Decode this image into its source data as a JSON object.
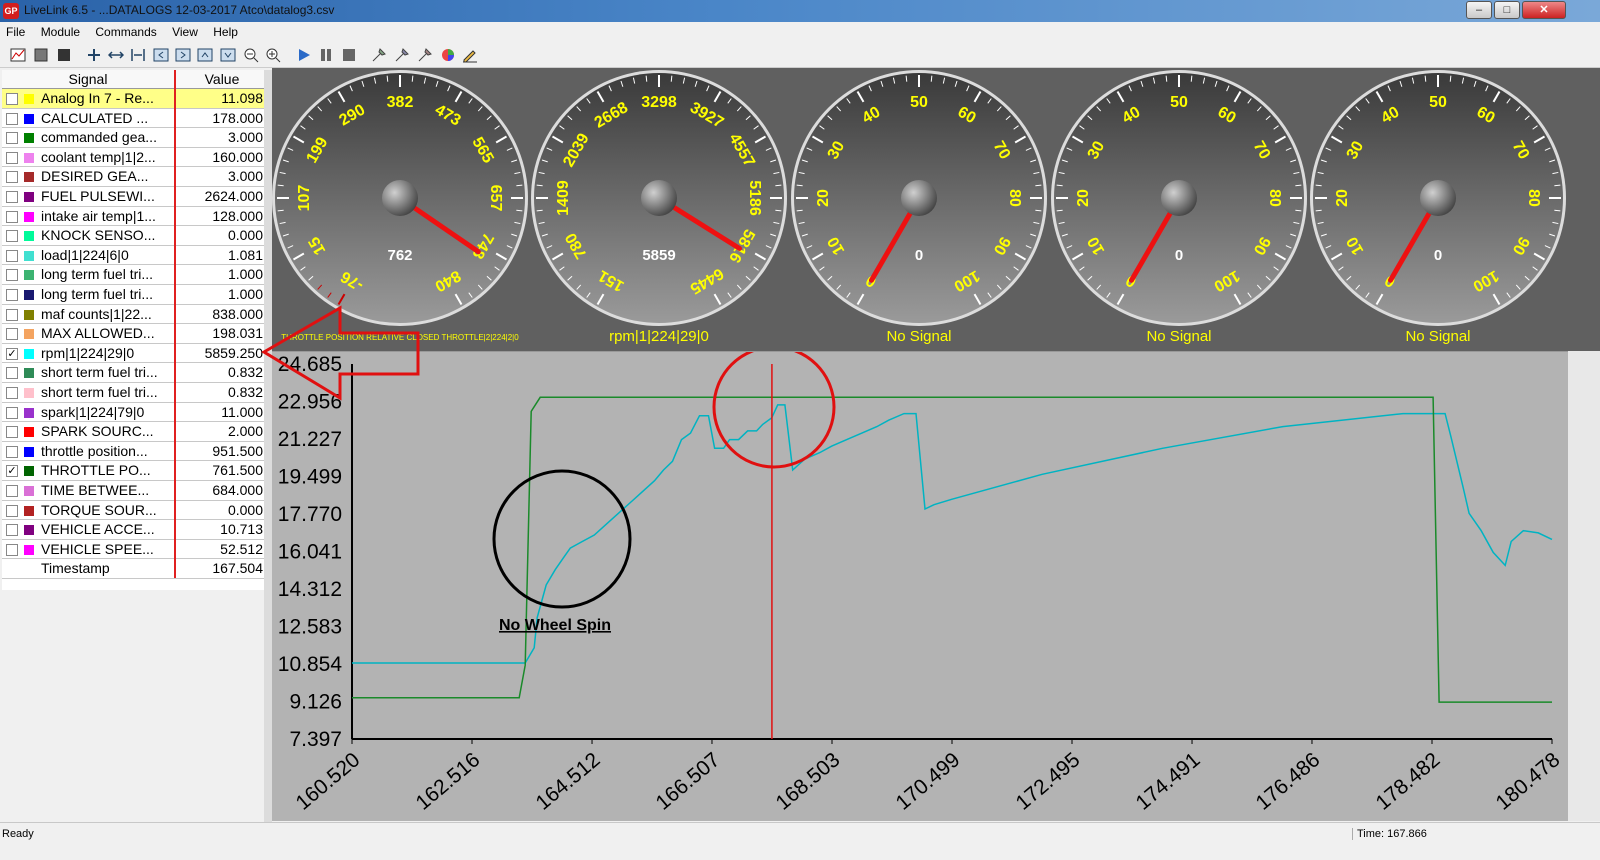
{
  "window": {
    "title": "LiveLink 6.5 - ...DATALOGS 12-03-2017 Atco\\datalog3.csv",
    "minimize": "–",
    "maximize": "□",
    "close": "✕"
  },
  "menu": [
    "File",
    "Module",
    "Commands",
    "View",
    "Help"
  ],
  "toolbar_icons": [
    "chart-icon",
    "stop-icon",
    "record-icon",
    "zoom-max-icon",
    "pan-icon",
    "fit-icon",
    "left-icon",
    "right-icon",
    "up-icon",
    "down-icon",
    "zoom-out-icon",
    "zoom-in-icon",
    "play-icon",
    "pause-icon",
    "stop-square-icon",
    "tool-a-icon",
    "tool-b-icon",
    "tool-c-icon",
    "color-icon",
    "pen-icon"
  ],
  "signals": {
    "header_signal": "Signal",
    "header_value": "Value",
    "rows": [
      {
        "name": "Analog In 7 - Re...",
        "value": "11.098",
        "color": "#ffff00",
        "checked": false,
        "highlight": true
      },
      {
        "name": "CALCULATED ...",
        "value": "178.000",
        "color": "#0000ff",
        "checked": false
      },
      {
        "name": "commanded gea...",
        "value": "3.000",
        "color": "#008000",
        "checked": false
      },
      {
        "name": "coolant temp|1|2...",
        "value": "160.000",
        "color": "#ee82ee",
        "checked": false
      },
      {
        "name": "DESIRED GEA...",
        "value": "3.000",
        "color": "#a52a2a",
        "checked": false
      },
      {
        "name": "FUEL PULSEWI...",
        "value": "2624.000",
        "color": "#800080",
        "checked": false
      },
      {
        "name": "intake air temp|1...",
        "value": "128.000",
        "color": "#ff00ff",
        "checked": false
      },
      {
        "name": "KNOCK SENSO...",
        "value": "0.000",
        "color": "#00fa9a",
        "checked": false
      },
      {
        "name": "load|1|224|6|0",
        "value": "1.081",
        "color": "#40e0d0",
        "checked": false
      },
      {
        "name": "long term fuel tri...",
        "value": "1.000",
        "color": "#3cb371",
        "checked": false
      },
      {
        "name": "long term fuel tri...",
        "value": "1.000",
        "color": "#191970",
        "checked": false
      },
      {
        "name": "maf counts|1|22...",
        "value": "838.000",
        "color": "#808000",
        "checked": false
      },
      {
        "name": "MAX ALLOWED...",
        "value": "198.031",
        "color": "#f4a460",
        "checked": false
      },
      {
        "name": "rpm|1|224|29|0",
        "value": "5859.250",
        "color": "#00ffff",
        "checked": true
      },
      {
        "name": "short term fuel tri...",
        "value": "0.832",
        "color": "#2e8b57",
        "checked": false
      },
      {
        "name": "short term fuel tri...",
        "value": "0.832",
        "color": "#ffc0cb",
        "checked": false
      },
      {
        "name": "spark|1|224|79|0",
        "value": "11.000",
        "color": "#9932cc",
        "checked": false
      },
      {
        "name": "SPARK SOURC...",
        "value": "2.000",
        "color": "#ff0000",
        "checked": false
      },
      {
        "name": "throttle position...",
        "value": "951.500",
        "color": "#0000ff",
        "checked": false
      },
      {
        "name": "THROTTLE PO...",
        "value": "761.500",
        "color": "#006400",
        "checked": true
      },
      {
        "name": "TIME BETWEE...",
        "value": "684.000",
        "color": "#da70d6",
        "checked": false
      },
      {
        "name": "TORQUE SOUR...",
        "value": "0.000",
        "color": "#b22222",
        "checked": false
      },
      {
        "name": "VEHICLE ACCE...",
        "value": "10.713",
        "color": "#800080",
        "checked": false
      },
      {
        "name": "VEHICLE SPEE...",
        "value": "52.512",
        "color": "#ff00ff",
        "checked": false
      }
    ],
    "timestamp_label": "Timestamp",
    "timestamp_value": "167.504",
    "check_mark": "✓"
  },
  "gauges": [
    {
      "ticks": [
        "-76",
        "15",
        "107",
        "199",
        "290",
        "382",
        "473",
        "565",
        "657",
        "748",
        "840"
      ],
      "min": -76,
      "max": 840,
      "readout": "762",
      "value": 762,
      "caption": "THROTTLE POSITION RELATIVE CLOSED THROTTLE|2|224|2|0",
      "small_caption": true
    },
    {
      "ticks": [
        "151",
        "780",
        "1409",
        "2039",
        "2668",
        "3298",
        "3927",
        "4557",
        "5186",
        "5816",
        "6445"
      ],
      "min": 151,
      "max": 6445,
      "readout": "5859",
      "value": 5859,
      "caption": "rpm|1|224|29|0",
      "small_caption": false
    },
    {
      "ticks": [
        "0",
        "10",
        "20",
        "30",
        "40",
        "50",
        "60",
        "70",
        "80",
        "90",
        "100"
      ],
      "min": 0,
      "max": 100,
      "readout": "0",
      "value": 0,
      "caption": "No Signal",
      "small_caption": false
    },
    {
      "ticks": [
        "0",
        "10",
        "20",
        "30",
        "40",
        "50",
        "60",
        "70",
        "80",
        "90",
        "100"
      ],
      "min": 0,
      "max": 100,
      "readout": "0",
      "value": 0,
      "caption": "No Signal",
      "small_caption": false
    },
    {
      "ticks": [
        "0",
        "10",
        "20",
        "30",
        "40",
        "50",
        "60",
        "70",
        "80",
        "90",
        "100"
      ],
      "min": 0,
      "max": 100,
      "readout": "0",
      "value": 0,
      "caption": "No Signal",
      "small_caption": false
    }
  ],
  "chart_data": {
    "type": "line",
    "xlim": [
      160.52,
      180.478
    ],
    "ylim": [
      7.397,
      24.685
    ],
    "x_ticks": [
      "160.520",
      "162.516",
      "164.512",
      "166.507",
      "168.503",
      "170.499",
      "172.495",
      "174.491",
      "176.486",
      "178.482",
      "180.478"
    ],
    "y_ticks": [
      "24.685",
      "22.956",
      "21.227",
      "19.499",
      "17.770",
      "16.041",
      "14.312",
      "12.583",
      "10.854",
      "9.126",
      "7.397"
    ],
    "cursor_x": 167.504,
    "grid": false,
    "series": [
      {
        "color": "#00b3c2",
        "x": [
          160.52,
          163.4,
          163.55,
          163.6,
          163.75,
          163.9,
          164.05,
          164.15,
          164.35,
          164.55,
          164.75,
          164.95,
          165.15,
          165.35,
          165.55,
          165.7,
          165.85,
          166.0,
          166.15,
          166.3,
          166.45,
          166.55,
          166.7,
          166.8,
          166.95,
          167.1,
          167.25,
          167.35,
          167.5,
          167.6,
          167.72,
          167.85,
          168.05,
          168.3,
          168.5,
          168.75,
          169.0,
          169.25,
          169.45,
          169.7,
          169.9,
          170.05,
          170.2,
          170.5,
          172.0,
          174.0,
          176.0,
          178.0,
          178.7,
          178.8,
          179.0,
          179.1,
          179.3,
          179.5,
          179.7,
          179.8,
          180.0,
          180.25,
          180.478
        ],
        "y": [
          10.9,
          10.9,
          11.6,
          13.0,
          14.5,
          15.2,
          15.8,
          16.2,
          16.5,
          16.8,
          17.3,
          17.8,
          18.3,
          18.8,
          19.3,
          19.8,
          20.2,
          21.2,
          21.5,
          22.3,
          22.3,
          20.8,
          20.8,
          21.2,
          21.2,
          21.6,
          21.6,
          21.9,
          22.2,
          22.8,
          22.8,
          19.8,
          20.3,
          20.6,
          20.9,
          21.2,
          21.5,
          21.8,
          22.1,
          22.4,
          22.4,
          18.0,
          18.2,
          18.45,
          19.6,
          20.8,
          21.8,
          22.4,
          22.4,
          21.3,
          19.0,
          17.8,
          17.0,
          16.0,
          15.4,
          16.5,
          17.0,
          16.9,
          16.6
        ]
      },
      {
        "color": "#1a8a2a",
        "x": [
          160.52,
          163.3,
          163.4,
          163.5,
          163.65,
          178.5,
          178.6,
          180.478
        ],
        "y": [
          9.3,
          9.3,
          10.8,
          22.5,
          23.15,
          23.15,
          9.1,
          9.1
        ]
      }
    ],
    "annotation": "No Wheel Spin"
  },
  "status": {
    "left": "Ready",
    "time": "Time: 167.866"
  }
}
